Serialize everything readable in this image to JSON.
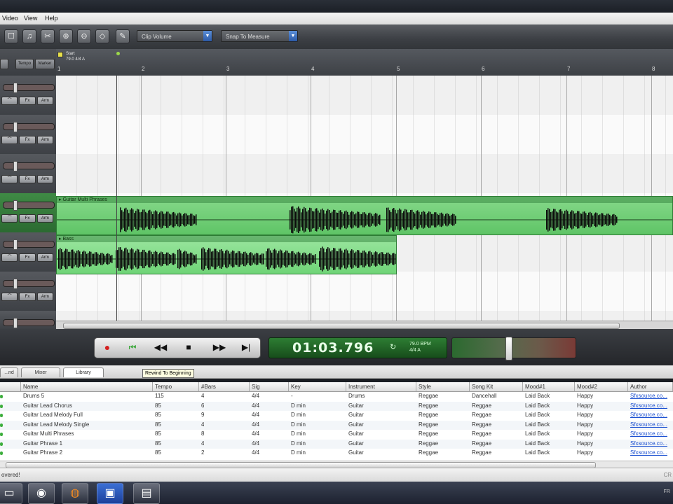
{
  "menu": {
    "items": [
      "Video",
      "View",
      "Help"
    ]
  },
  "toolbar": {
    "tools": [
      "select-tool",
      "speaker-tool",
      "split-tool",
      "zoom-in-tool",
      "zoom-out-tool",
      "envelope-tool",
      "draw-tool"
    ],
    "clip_mode": "Clip Volume",
    "snap_mode": "Snap To Measure"
  },
  "ruler": {
    "buttons": [
      "Tempo",
      "Marker"
    ],
    "marker_title": "Start",
    "marker_sub": "79.0 4/4 A",
    "measures": [
      "1",
      "2",
      "3",
      "4",
      "5",
      "6",
      "7",
      "8"
    ]
  },
  "tracks": {
    "header_buttons": [
      "⌒",
      "Fx",
      "Arm"
    ],
    "active_index": 3
  },
  "clips": [
    {
      "title": "Guitar Multi Phrases",
      "track": 3
    },
    {
      "title": "Bass",
      "track": 4
    }
  ],
  "transport": {
    "time": "01:03.796",
    "bpm": "79.0 BPM",
    "signature": "4/4 A",
    "buttons": [
      "record-button",
      "rewind-to-beginning-button",
      "rewind-button",
      "stop-button",
      "fast-forward-button",
      "go-to-end-button"
    ]
  },
  "tabs": [
    {
      "label": "...nd",
      "selected": false
    },
    {
      "label": "Mixer",
      "selected": false
    },
    {
      "label": "Library",
      "selected": true
    }
  ],
  "tooltip": "Rewind To Beginning",
  "library": {
    "columns": [
      "Name",
      "Tempo",
      "#Bars",
      "Sig",
      "Key",
      "Instrument",
      "Style",
      "Song Kit",
      "Mood#1",
      "Mood#2",
      "Author"
    ],
    "rows": [
      [
        "Drums 5",
        "115",
        "4",
        "4/4",
        "-",
        "Drums",
        "Reggae",
        "Dancehall",
        "Laid Back",
        "Happy",
        "Sfxsource.co..."
      ],
      [
        "Guitar Lead Chorus",
        "85",
        "6",
        "4/4",
        "D min",
        "Guitar",
        "Reggae",
        "Reggae",
        "Laid Back",
        "Happy",
        "Sfxsource.co..."
      ],
      [
        "Guitar Lead Melody Full",
        "85",
        "9",
        "4/4",
        "D min",
        "Guitar",
        "Reggae",
        "Reggae",
        "Laid Back",
        "Happy",
        "Sfxsource.co..."
      ],
      [
        "Guitar Lead Melody Single",
        "85",
        "4",
        "4/4",
        "D min",
        "Guitar",
        "Reggae",
        "Reggae",
        "Laid Back",
        "Happy",
        "Sfxsource.co..."
      ],
      [
        "Guitar Multi Phrases",
        "85",
        "8",
        "4/4",
        "D min",
        "Guitar",
        "Reggae",
        "Reggae",
        "Laid Back",
        "Happy",
        "Sfxsource.co..."
      ],
      [
        "Guitar Phrase 1",
        "85",
        "4",
        "4/4",
        "D min",
        "Guitar",
        "Reggae",
        "Reggae",
        "Laid Back",
        "Happy",
        "Sfxsource.co..."
      ],
      [
        "Guitar Phrase 2",
        "85",
        "2",
        "4/4",
        "D min",
        "Guitar",
        "Reggae",
        "Reggae",
        "Laid Back",
        "Happy",
        "Sfxsource.co..."
      ]
    ]
  },
  "status": {
    "left": "overed!",
    "right": "CR"
  },
  "taskbar": {
    "apps": [
      "folder-app",
      "media-app",
      "firefox-app",
      "blue-app",
      "window-app"
    ],
    "tray": "FR"
  },
  "colors": {
    "clip_green": "#78d17e",
    "clip_green_dark": "#4fb356",
    "record_red": "#d42020"
  }
}
